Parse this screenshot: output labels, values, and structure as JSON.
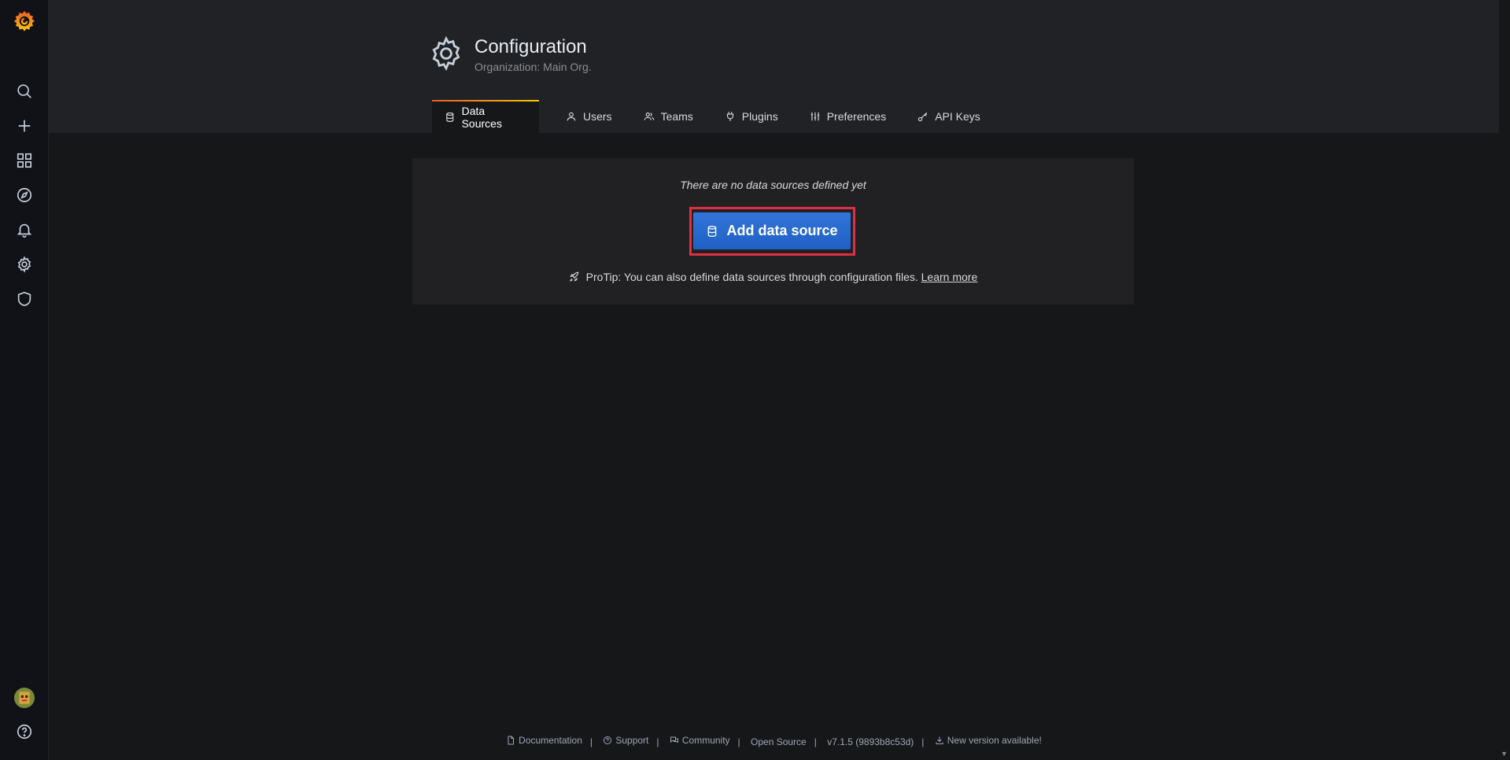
{
  "sidebar": {
    "items": [
      {
        "name": "grafana-logo",
        "icon": "grafana-logo"
      },
      {
        "name": "search",
        "icon": "search-icon"
      },
      {
        "name": "create",
        "icon": "plus-icon"
      },
      {
        "name": "dashboards",
        "icon": "apps-icon"
      },
      {
        "name": "explore",
        "icon": "compass-icon"
      },
      {
        "name": "alerting",
        "icon": "bell-icon"
      },
      {
        "name": "configuration",
        "icon": "cog-icon"
      },
      {
        "name": "server-admin",
        "icon": "shield-icon"
      },
      {
        "name": "profile",
        "icon": "avatar"
      },
      {
        "name": "help",
        "icon": "question-icon"
      }
    ]
  },
  "header": {
    "title": "Configuration",
    "subtitle": "Organization: Main Org.",
    "tabs": [
      {
        "label": "Data Sources",
        "icon": "database-icon",
        "active": true
      },
      {
        "label": "Users",
        "icon": "user-icon"
      },
      {
        "label": "Teams",
        "icon": "users-icon"
      },
      {
        "label": "Plugins",
        "icon": "plug-icon"
      },
      {
        "label": "Preferences",
        "icon": "sliders-icon"
      },
      {
        "label": "API Keys",
        "icon": "key-icon"
      }
    ]
  },
  "main": {
    "empty_message": "There are no data sources defined yet",
    "add_button_label": "Add data source",
    "protip_text": "ProTip: You can also define data sources through configuration files.",
    "learn_more_label": "Learn more"
  },
  "footer": {
    "documentation": "Documentation",
    "support": "Support",
    "community": "Community",
    "open_source": "Open Source",
    "version": "v7.1.5 (9893b8c53d)",
    "new_version": "New version available!"
  },
  "colors": {
    "accent_blue": "#3274d9",
    "highlight_red": "#e02f44",
    "tab_gradient_start": "#f05a28",
    "tab_gradient_end": "#fbca0a"
  }
}
